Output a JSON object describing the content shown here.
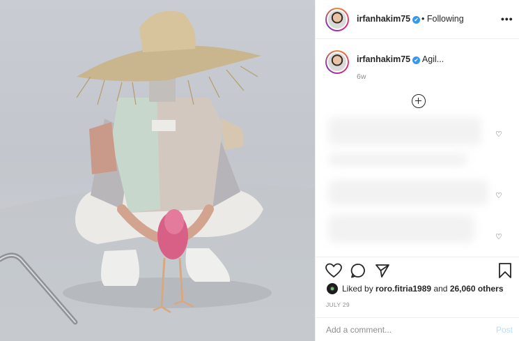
{
  "post": {
    "username": "irfanhakim75",
    "verified_badge": "✔",
    "separator": "•",
    "follow_status": "Following",
    "more_icon": "more-horizontal-icon",
    "more_label": "•••"
  },
  "caption": {
    "username": "irfanhakim75",
    "text": "Agil...",
    "age": "6w"
  },
  "comments_preview": {
    "load_more_icon": "plus-circle-icon"
  },
  "actions": {
    "like_icon": "heart-icon",
    "comment_icon": "comment-icon",
    "share_icon": "paper-plane-icon",
    "save_icon": "bookmark-icon"
  },
  "likes": {
    "prefix": "Liked by",
    "user": "roro.fitria1989",
    "conj": "and",
    "count": "26,060 others"
  },
  "date": "JULY 29",
  "comment": {
    "placeholder": "Add a comment...",
    "post_label": "Post"
  },
  "colors": {
    "verified": "#3897f0",
    "post_button": "#b2dffc",
    "muted": "#8e8e8e",
    "text": "#262626"
  }
}
